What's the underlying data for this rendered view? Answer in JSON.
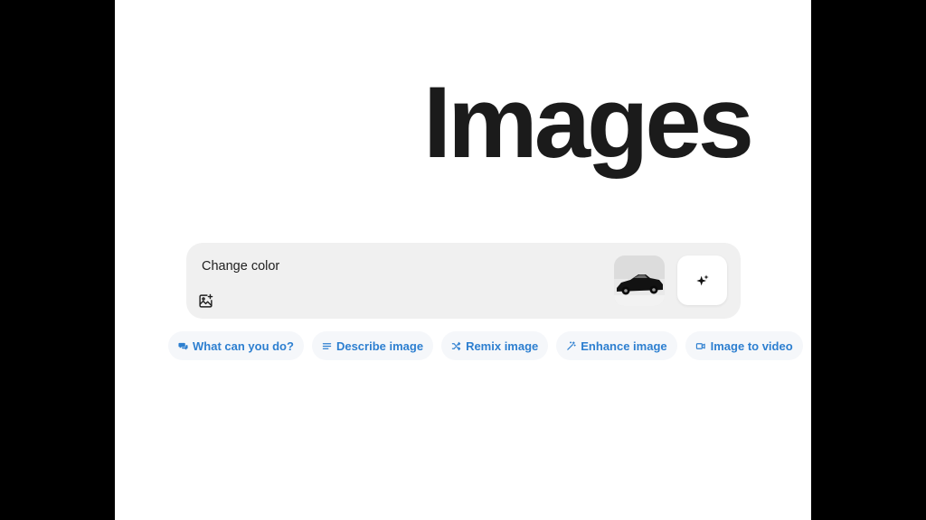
{
  "page": {
    "title": "Images"
  },
  "composer": {
    "prompt_value": "Change color",
    "add_image_icon": "image-plus-icon",
    "thumbnail_alt": "car-thumbnail",
    "generate_icon": "sparkles-icon"
  },
  "suggestions": [
    {
      "label": "What can you do?",
      "icon": "chat-bubbles-icon"
    },
    {
      "label": "Describe image",
      "icon": "lines-icon"
    },
    {
      "label": "Remix image",
      "icon": "shuffle-icon"
    },
    {
      "label": "Enhance image",
      "icon": "magic-wand-icon"
    },
    {
      "label": "Image to video",
      "icon": "video-camera-icon"
    }
  ],
  "colors": {
    "accent": "#2d7fd0",
    "composer_bg": "#f0f0f0",
    "chip_bg": "#f5f7fa",
    "title": "#1b1b1b"
  }
}
